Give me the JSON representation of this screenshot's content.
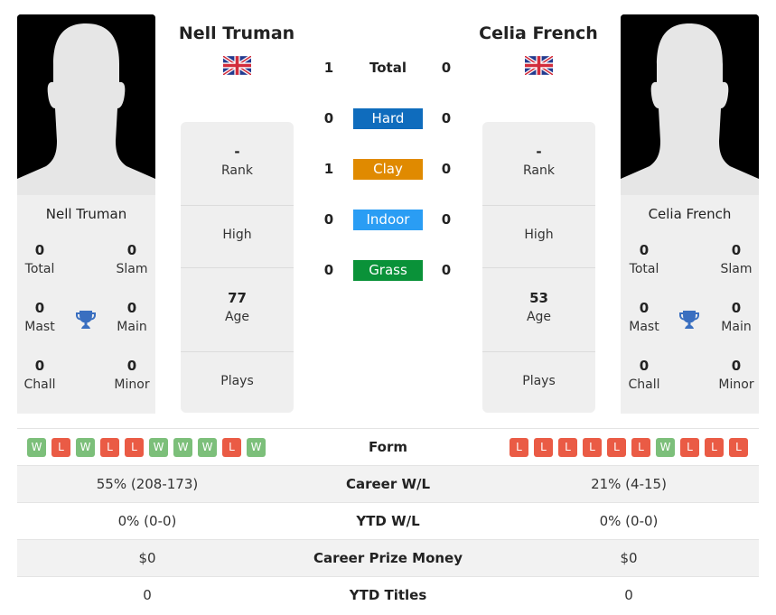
{
  "player_left": {
    "name": "Nell Truman",
    "country_flag": "uk-flag",
    "card_name": "Nell Truman",
    "titles": {
      "total": {
        "value": "0",
        "label": "Total"
      },
      "slam": {
        "value": "0",
        "label": "Slam"
      },
      "mast": {
        "value": "0",
        "label": "Mast"
      },
      "main": {
        "value": "0",
        "label": "Main"
      },
      "chall": {
        "value": "0",
        "label": "Chall"
      },
      "minor": {
        "value": "0",
        "label": "Minor"
      }
    },
    "info": {
      "rank": {
        "value": "-",
        "label": "Rank"
      },
      "high": {
        "value": "",
        "label": "High"
      },
      "age": {
        "value": "77",
        "label": "Age"
      },
      "plays": {
        "value": "",
        "label": "Plays"
      }
    },
    "form": [
      "W",
      "L",
      "W",
      "L",
      "L",
      "W",
      "W",
      "W",
      "L",
      "W"
    ],
    "career_wl": "55% (208-173)",
    "ytd_wl": "0% (0-0)",
    "career_prize": "$0",
    "ytd_titles": "0"
  },
  "player_right": {
    "name": "Celia French",
    "country_flag": "uk-flag",
    "card_name": "Celia French",
    "titles": {
      "total": {
        "value": "0",
        "label": "Total"
      },
      "slam": {
        "value": "0",
        "label": "Slam"
      },
      "mast": {
        "value": "0",
        "label": "Mast"
      },
      "main": {
        "value": "0",
        "label": "Main"
      },
      "chall": {
        "value": "0",
        "label": "Chall"
      },
      "minor": {
        "value": "0",
        "label": "Minor"
      }
    },
    "info": {
      "rank": {
        "value": "-",
        "label": "Rank"
      },
      "high": {
        "value": "",
        "label": "High"
      },
      "age": {
        "value": "53",
        "label": "Age"
      },
      "plays": {
        "value": "",
        "label": "Plays"
      }
    },
    "form": [
      "L",
      "L",
      "L",
      "L",
      "L",
      "L",
      "W",
      "L",
      "L",
      "L"
    ],
    "career_wl": "21% (4-15)",
    "ytd_wl": "0% (0-0)",
    "career_prize": "$0",
    "ytd_titles": "0"
  },
  "h2h": {
    "total": {
      "label": "Total",
      "left": "1",
      "right": "0"
    },
    "surfaces": [
      {
        "label": "Hard",
        "left": "0",
        "right": "0",
        "color": "#0f6cbd"
      },
      {
        "label": "Clay",
        "left": "1",
        "right": "0",
        "color": "#e08a00"
      },
      {
        "label": "Indoor",
        "left": "0",
        "right": "0",
        "color": "#2a9df4"
      },
      {
        "label": "Grass",
        "left": "0",
        "right": "0",
        "color": "#0a9239"
      }
    ]
  },
  "comparison_labels": {
    "form": "Form",
    "career_wl": "Career W/L",
    "ytd_wl": "YTD W/L",
    "career_prize": "Career Prize Money",
    "ytd_titles": "YTD Titles"
  },
  "colors": {
    "win": "#7cbf7a",
    "loss": "#ea5b45",
    "trophy": "#3a6fc0"
  }
}
